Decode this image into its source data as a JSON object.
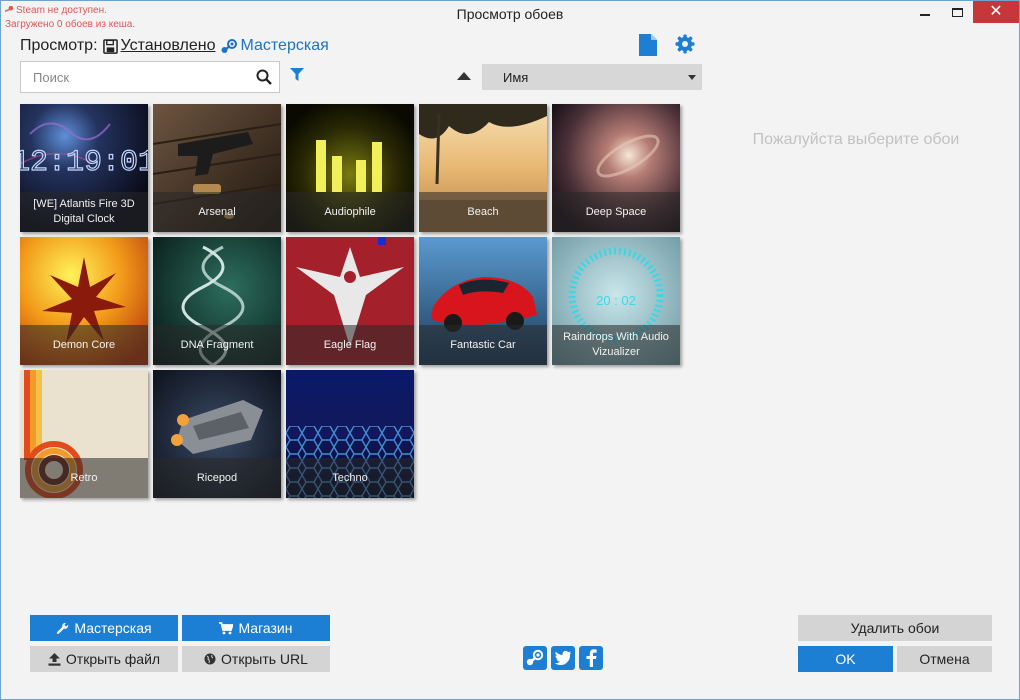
{
  "window": {
    "title": "Просмотр обоев",
    "status_line1": "Steam не доступен.",
    "status_line2": "Загружено 0 обоев из кеша."
  },
  "view": {
    "label": "Просмотр:",
    "installed": "Установлено",
    "workshop": "Мастерская"
  },
  "search": {
    "placeholder": "Поиск"
  },
  "sort": {
    "field": "Имя"
  },
  "wallpapers": [
    {
      "title": "[WE] Atlantis Fire 3D Digital Clock",
      "clock": "12:19:01"
    },
    {
      "title": "Arsenal"
    },
    {
      "title": "Audiophile"
    },
    {
      "title": "Beach"
    },
    {
      "title": "Deep Space"
    },
    {
      "title": "Demon Core"
    },
    {
      "title": "DNA Fragment"
    },
    {
      "title": "Eagle Flag"
    },
    {
      "title": "Fantastic Car"
    },
    {
      "title": "Raindrops With Audio Vizualizer",
      "clock": "20 : 02"
    },
    {
      "title": "Retro"
    },
    {
      "title": "Ricepod"
    },
    {
      "title": "Techno"
    }
  ],
  "detail": {
    "placeholder": "Пожалуйста выберите обои"
  },
  "buttons": {
    "workshop": "Мастерская",
    "shop": "Магазин",
    "open_file": "Открыть файл",
    "open_url": "Открыть URL",
    "delete": "Удалить обои",
    "ok": "OK",
    "cancel": "Отмена"
  },
  "colors": {
    "accent": "#1c7fd4",
    "close": "#c7363a",
    "status": "#e05555"
  }
}
